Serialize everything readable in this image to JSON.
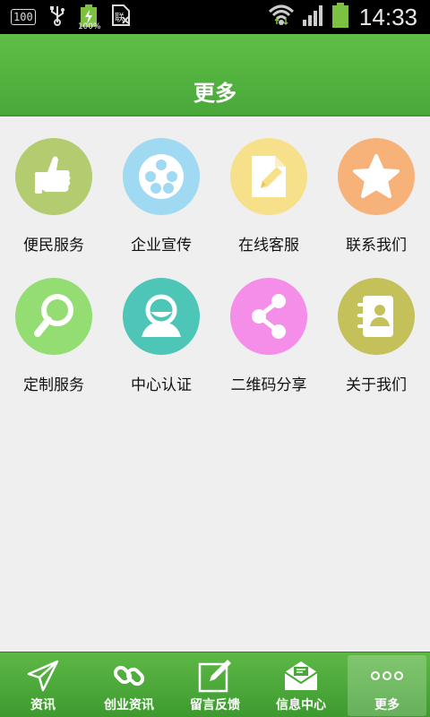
{
  "status_bar": {
    "badge_text": "100",
    "battery_small_pct": "100%",
    "time": "14:33",
    "icons": [
      "sd-card-icon",
      "usb-icon",
      "battery-charging-icon",
      "sim-icon",
      "wifi-icon",
      "signal-icon",
      "battery-icon"
    ]
  },
  "header": {
    "title": "更多"
  },
  "grid": {
    "items": [
      {
        "label": "便民服务",
        "icon": "thumbs-up-icon",
        "color": "#b3cc6f"
      },
      {
        "label": "企业宣传",
        "icon": "film-reel-icon",
        "color": "#9fd9f2"
      },
      {
        "label": "在线客服",
        "icon": "edit-document-icon",
        "color": "#f7e08a"
      },
      {
        "label": "联系我们",
        "icon": "star-icon",
        "color": "#f7b27a"
      },
      {
        "label": "定制服务",
        "icon": "magnifier-icon",
        "color": "#93dd72"
      },
      {
        "label": "中心认证",
        "icon": "user-icon",
        "color": "#4ec6b7"
      },
      {
        "label": "二维码分享",
        "icon": "share-icon",
        "color": "#f48ee8"
      },
      {
        "label": "关于我们",
        "icon": "contact-book-icon",
        "color": "#c4c05a"
      }
    ]
  },
  "bottom_nav": {
    "items": [
      {
        "label": "资讯",
        "icon": "paper-plane-icon"
      },
      {
        "label": "创业资讯",
        "icon": "link-icon"
      },
      {
        "label": "留言反馈",
        "icon": "edit-icon"
      },
      {
        "label": "信息中心",
        "icon": "envelope-icon"
      },
      {
        "label": "更多",
        "icon": "more-dots-icon",
        "active": true
      }
    ]
  }
}
